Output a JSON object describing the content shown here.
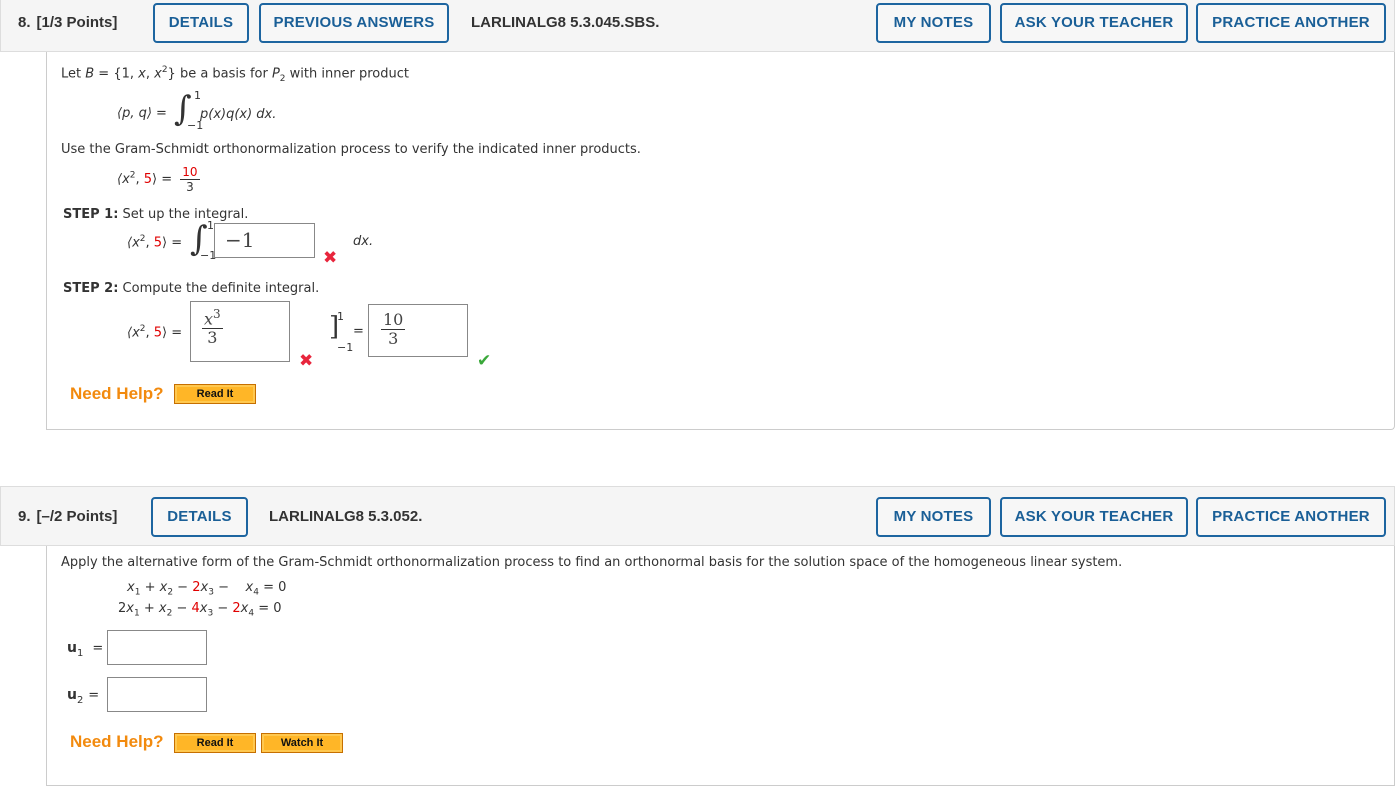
{
  "q8": {
    "number": "8.",
    "points": "[1/3 Points]",
    "buttons": {
      "details": "DETAILS",
      "previous_answers": "PREVIOUS ANSWERS",
      "my_notes": "MY NOTES",
      "ask_teacher": "ASK YOUR TEACHER",
      "practice_another": "PRACTICE ANOTHER"
    },
    "code": "LARLINALG8 5.3.045.SBS.",
    "intro": {
      "let": "Let ",
      "B": "B",
      "set": " = {1, ",
      "x": "x",
      "comma": ", ",
      "x2": "x",
      "sup2": "2",
      "close": "} be a basis for ",
      "P": "P",
      "sub2": "2",
      "rest": " with inner product"
    },
    "inner_product": {
      "lhs": "⟨p, q⟩ =",
      "integrand": "p(x)q(x) dx.",
      "upper": "1",
      "lower": "−1"
    },
    "instruction": "Use the Gram-Schmidt orthonormalization process to verify the indicated inner products.",
    "given": {
      "lhs_open": "⟨x",
      "sup": "2",
      "comma": ", ",
      "five": "5",
      "close": "⟩ =",
      "num": "10",
      "den": "3"
    },
    "step1": {
      "label": "STEP 1:",
      "text": " Set up the integral.",
      "upper": "1",
      "lower": "−1",
      "answer": "−1",
      "dx": "dx.",
      "status": "incorrect"
    },
    "step2": {
      "label": "STEP 2:",
      "text": " Compute the definite integral.",
      "antiderivative": {
        "num": "x",
        "num_sup": "3",
        "den": "3"
      },
      "antiderivative_status": "incorrect",
      "upper": "1",
      "lower": "−1",
      "result": {
        "num": "10",
        "den": "3"
      },
      "result_status": "correct"
    },
    "need_help": "Need Help?",
    "read_it": "Read It"
  },
  "q9": {
    "number": "9.",
    "points": "[–/2 Points]",
    "buttons": {
      "details": "DETAILS",
      "my_notes": "MY NOTES",
      "ask_teacher": "ASK YOUR TEACHER",
      "practice_another": "PRACTICE ANOTHER"
    },
    "code": "LARLINALG8 5.3.052.",
    "prompt": "Apply the alternative form of the Gram-Schmidt orthonormalization process to find an orthonormal basis for the solution space of the homogeneous linear system.",
    "equations": [
      {
        "c1": "",
        "c2": "",
        "c3": "2",
        "op3": "−",
        "c4": "",
        "rhs": "0"
      },
      {
        "c1": "2",
        "c2": "",
        "c3": "4",
        "op3": "−",
        "c4": "2",
        "rhs": "0"
      }
    ],
    "u1_label": "u",
    "u1_sub": "1",
    "u1_value": "",
    "u2_label": "u",
    "u2_sub": "2",
    "u2_value": "",
    "need_help": "Need Help?",
    "read_it": "Read It",
    "watch_it": "Watch It"
  },
  "marks": {
    "incorrect": "✖",
    "correct": "✔"
  }
}
